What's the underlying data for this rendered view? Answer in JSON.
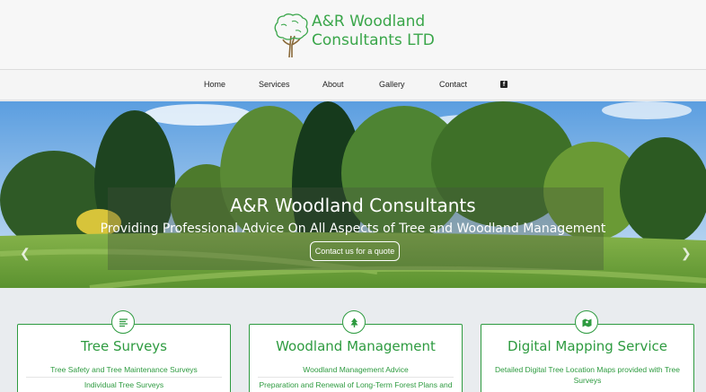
{
  "brand": {
    "line1": "A&R Woodland",
    "line2": "Consultants LTD"
  },
  "nav": {
    "items": [
      "Home",
      "Services",
      "About",
      "Gallery",
      "Contact"
    ],
    "facebook_icon": "facebook-icon"
  },
  "hero": {
    "title": "A&R Woodland Consultants",
    "subtitle": "Providing Professional Advice On All Aspects of Tree and Woodland Management",
    "button": "Contact us for a quote"
  },
  "cards": [
    {
      "icon": "list-icon",
      "title": "Tree Surveys",
      "lines": [
        "Tree Safety and Tree Maintenance Surveys",
        "Individual Tree Surveys"
      ]
    },
    {
      "icon": "tree-icon",
      "title": "Woodland Management",
      "lines": [
        "Woodland Management Advice",
        "Preparation and Renewal of Long-Term Forest Plans and"
      ]
    },
    {
      "icon": "map-icon",
      "title": "Digital Mapping Service",
      "lines": [
        "Detailed Digital Tree Location Maps provided with Tree Surveys"
      ]
    }
  ],
  "colors": {
    "brand_green": "#2e9b40",
    "header_bg": "#f7f7f7",
    "page_bg": "#e9ecef"
  }
}
